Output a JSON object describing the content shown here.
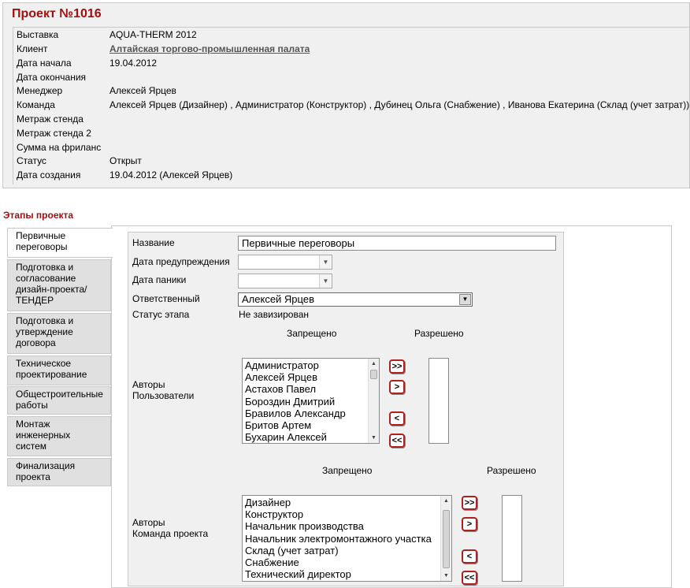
{
  "project": {
    "title": "Проект №1016",
    "fields": [
      {
        "label": "Выставка",
        "value": "AQUA-THERM 2012"
      },
      {
        "label": "Клиент",
        "value": "Алтайская торгово-промышленная палата"
      },
      {
        "label": "Дата начала",
        "value": "19.04.2012"
      },
      {
        "label": "Дата окончания",
        "value": ""
      },
      {
        "label": "Менеджер",
        "value": "Алексей Ярцев"
      },
      {
        "label": "Команда",
        "value": "Алексей Ярцев (Дизайнер) , Администратор (Конструктор) , Дубинец Ольга (Снабжение) , Иванова Екатерина (Склад (учет затрат))"
      },
      {
        "label": "Метраж стенда",
        "value": ""
      },
      {
        "label": "Метраж стенда 2",
        "value": ""
      },
      {
        "label": "Сумма на фриланс",
        "value": ""
      },
      {
        "label": "Статус",
        "value": "Открыт"
      },
      {
        "label": "Дата создания",
        "value": "19.04.2012 (Алексей Ярцев)"
      }
    ]
  },
  "stages": {
    "heading": "Этапы проекта",
    "tabs": [
      {
        "label": "Первичные переговоры"
      },
      {
        "label": "Подготовка и согласование дизайн-проекта/ТЕНДЕР"
      },
      {
        "label": "Подготовка и утверждение договора"
      },
      {
        "label": "Техническое проектирование"
      },
      {
        "label": "Общестроительные работы"
      },
      {
        "label": "Монтаж инженерных систем"
      },
      {
        "label": "Финализация проекта"
      }
    ]
  },
  "form": {
    "name_label": "Название",
    "name_value": "Первичные переговоры",
    "warn_date_label": "Дата предупреждения",
    "warn_date_value": "",
    "panic_date_label": "Дата паники",
    "panic_date_value": "",
    "responsible_label": "Ответственный",
    "responsible_value": "Алексей Ярцев",
    "status_label": "Статус этапа",
    "status_value": "Не завизирован",
    "authors_users": {
      "label_line1": "Авторы",
      "label_line2": "Пользователи",
      "denied_heading": "Запрещено",
      "allowed_heading": "Разрешено",
      "denied_items": [
        "Администратор",
        "Алексей Ярцев",
        "Астахов Павел",
        "Бороздин Дмитрий",
        "Бравилов Александр",
        "Бритов Артем",
        "Бухарин Алексей"
      ],
      "allowed_items": []
    },
    "authors_team": {
      "label_line1": "Авторы",
      "label_line2": "Команда проекта",
      "denied_heading": "Запрещено",
      "allowed_heading": "Разрешено",
      "denied_items": [
        "Дизайнер",
        "Конструктор",
        "Начальник производства",
        "Начальник электромонтажного участка",
        "Склад (учет затрат)",
        "Снабжение",
        "Технический директор"
      ],
      "allowed_items": []
    },
    "buttons": {
      "add_all": ">>",
      "add": ">",
      "remove": "<",
      "remove_all": "<<"
    }
  },
  "colors": {
    "accent": "#a01010",
    "panel": "#f0f0f0",
    "tab_inactive": "#e0e0e0",
    "button_border": "#b02020"
  },
  "icons": {
    "dropdown": "chevron-down-icon",
    "scroll_up": "scroll-up-icon",
    "scroll_down": "scroll-down-icon"
  }
}
